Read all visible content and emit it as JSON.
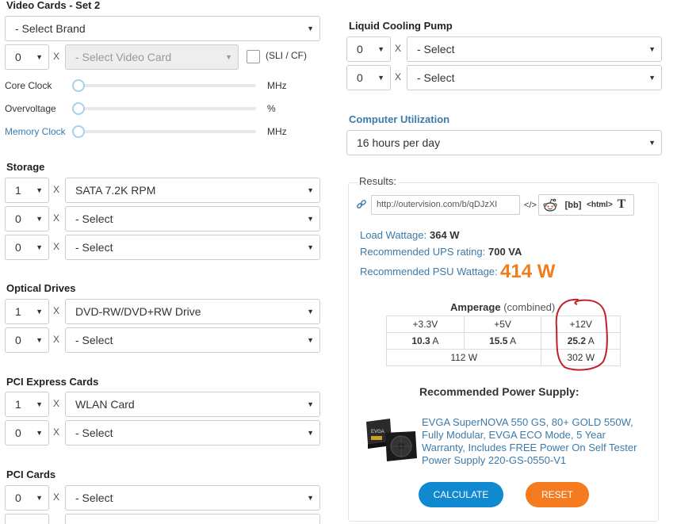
{
  "video_cards": {
    "title": "Video Cards - Set 2",
    "brand": "- Select Brand",
    "qty": "0",
    "x": "X",
    "card": "- Select Video Card",
    "sli_label": "(SLI / CF)",
    "sliders": [
      {
        "label": "Core Clock",
        "unit": "MHz"
      },
      {
        "label": "Overvoltage",
        "unit": "%"
      },
      {
        "label": "Memory Clock",
        "unit": "MHz"
      }
    ]
  },
  "storage": {
    "title": "Storage",
    "rows": [
      {
        "qty": "1",
        "value": "SATA 7.2K RPM"
      },
      {
        "qty": "0",
        "value": "- Select"
      },
      {
        "qty": "0",
        "value": "- Select"
      }
    ]
  },
  "optical": {
    "title": "Optical Drives",
    "rows": [
      {
        "qty": "1",
        "value": "DVD-RW/DVD+RW Drive"
      },
      {
        "qty": "0",
        "value": "- Select"
      }
    ]
  },
  "pcie": {
    "title": "PCI Express Cards",
    "rows": [
      {
        "qty": "1",
        "value": "WLAN Card"
      },
      {
        "qty": "0",
        "value": "- Select"
      }
    ]
  },
  "pci": {
    "title": "PCI Cards",
    "rows": [
      {
        "qty": "0",
        "value": "- Select"
      }
    ]
  },
  "liquid": {
    "title": "Liquid Cooling Pump",
    "rows": [
      {
        "qty": "0",
        "value": "- Select"
      },
      {
        "qty": "0",
        "value": "- Select"
      }
    ]
  },
  "utilization": {
    "title": "Computer Utilization",
    "value": "16 hours per day"
  },
  "results": {
    "title": "Results:",
    "url": "http://outervision.com/b/qDJzXI",
    "share": {
      "code": "</>",
      "bb": "[bb]",
      "html": "<html>",
      "t": "T"
    },
    "load_label": "Load Wattage:",
    "load_value": "364 W",
    "ups_label": "Recommended UPS rating:",
    "ups_value": "700 VA",
    "psu_label": "Recommended PSU Wattage:",
    "psu_value": "414 W",
    "amperage_title": "Amperage",
    "amperage_sub": "(combined)",
    "rails": [
      "+3.3V",
      "+5V",
      "+12V"
    ],
    "amps": [
      {
        "value": "10.3",
        "unit": "A"
      },
      {
        "value": "15.5",
        "unit": "A"
      },
      {
        "value": "25.2",
        "unit": "A"
      }
    ],
    "combined_watts": "112 W",
    "rail12_watts": "302 W",
    "rec_title": "Recommended Power Supply:",
    "product_link": "EVGA SuperNOVA 550 GS, 80+ GOLD 550W, Fully Modular, EVGA ECO Mode, 5 Year Warranty, Includes FREE Power On Self Tester Power Supply 220-GS-0550-V1",
    "calculate": "CALCULATE",
    "reset": "RESET"
  },
  "colors": {
    "accent_blue": "#3d7aa8",
    "psu_orange": "#f07d1c",
    "calculate_bg": "#1089d0",
    "reset_bg": "#f47b20",
    "annotation_red": "#c21f2a"
  }
}
